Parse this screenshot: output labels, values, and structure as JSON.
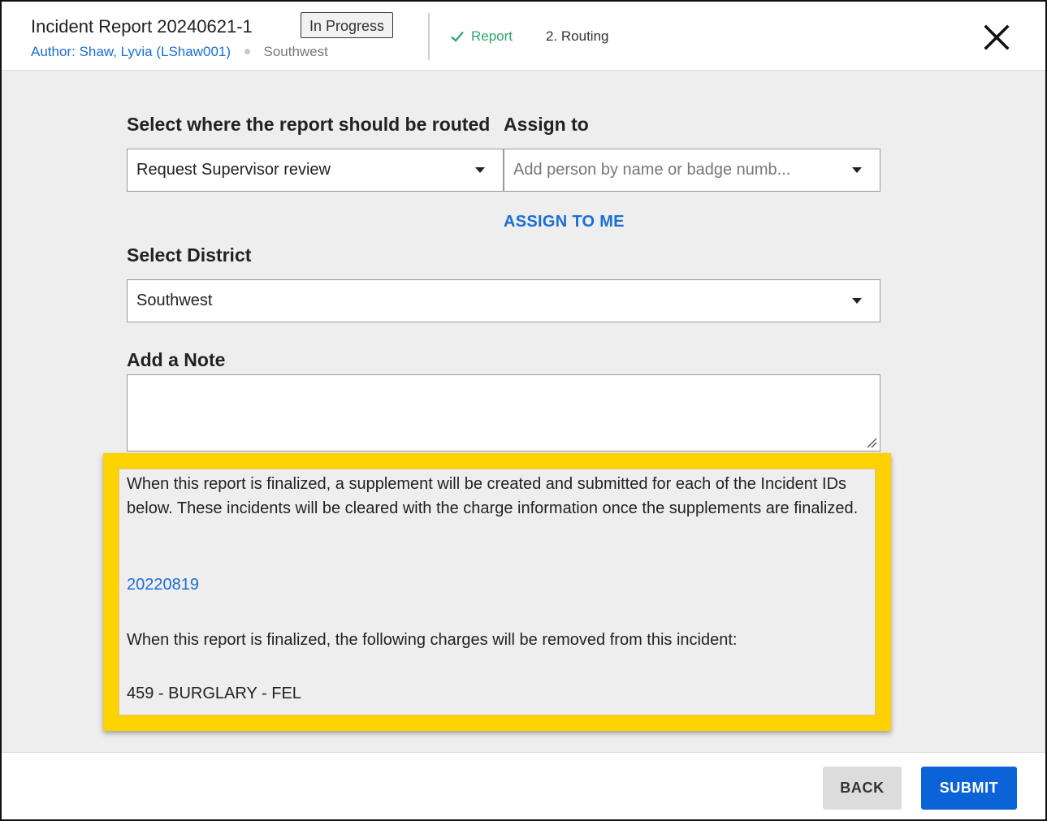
{
  "header": {
    "title": "Incident Report 20240621-1",
    "status": "In Progress",
    "author": "Author: Shaw, Lyvia (LShaw001)",
    "district": "Southwest",
    "steps": [
      {
        "label": "Report",
        "state": "complete"
      },
      {
        "label": "2. Routing",
        "state": "active"
      }
    ]
  },
  "routing": {
    "route_label": "Select where the report should be routed",
    "route_value": "Request Supervisor review",
    "assign_label": "Assign to",
    "assign_placeholder": "Add person by name or badge numb...",
    "assign_to_me": "ASSIGN TO ME",
    "district_label": "Select District",
    "district_value": "Southwest",
    "note_label": "Add a Note",
    "note_value": ""
  },
  "notice": {
    "supplement_text": "When this report is finalized, a supplement will be created and submitted for each of the Incident IDs below. These incidents will be cleared with the charge information once the supplements are finalized.",
    "incident_id": "20220819",
    "charges_text": "When this report is finalized, the following charges will be removed from this incident:",
    "charge": "459 - BURGLARY - FEL"
  },
  "footer": {
    "back_label": "BACK",
    "submit_label": "SUBMIT"
  },
  "colors": {
    "accent": "#1a6fd3",
    "submit": "#0c63d8",
    "highlight": "#fdd200",
    "complete": "#2ea66a"
  }
}
